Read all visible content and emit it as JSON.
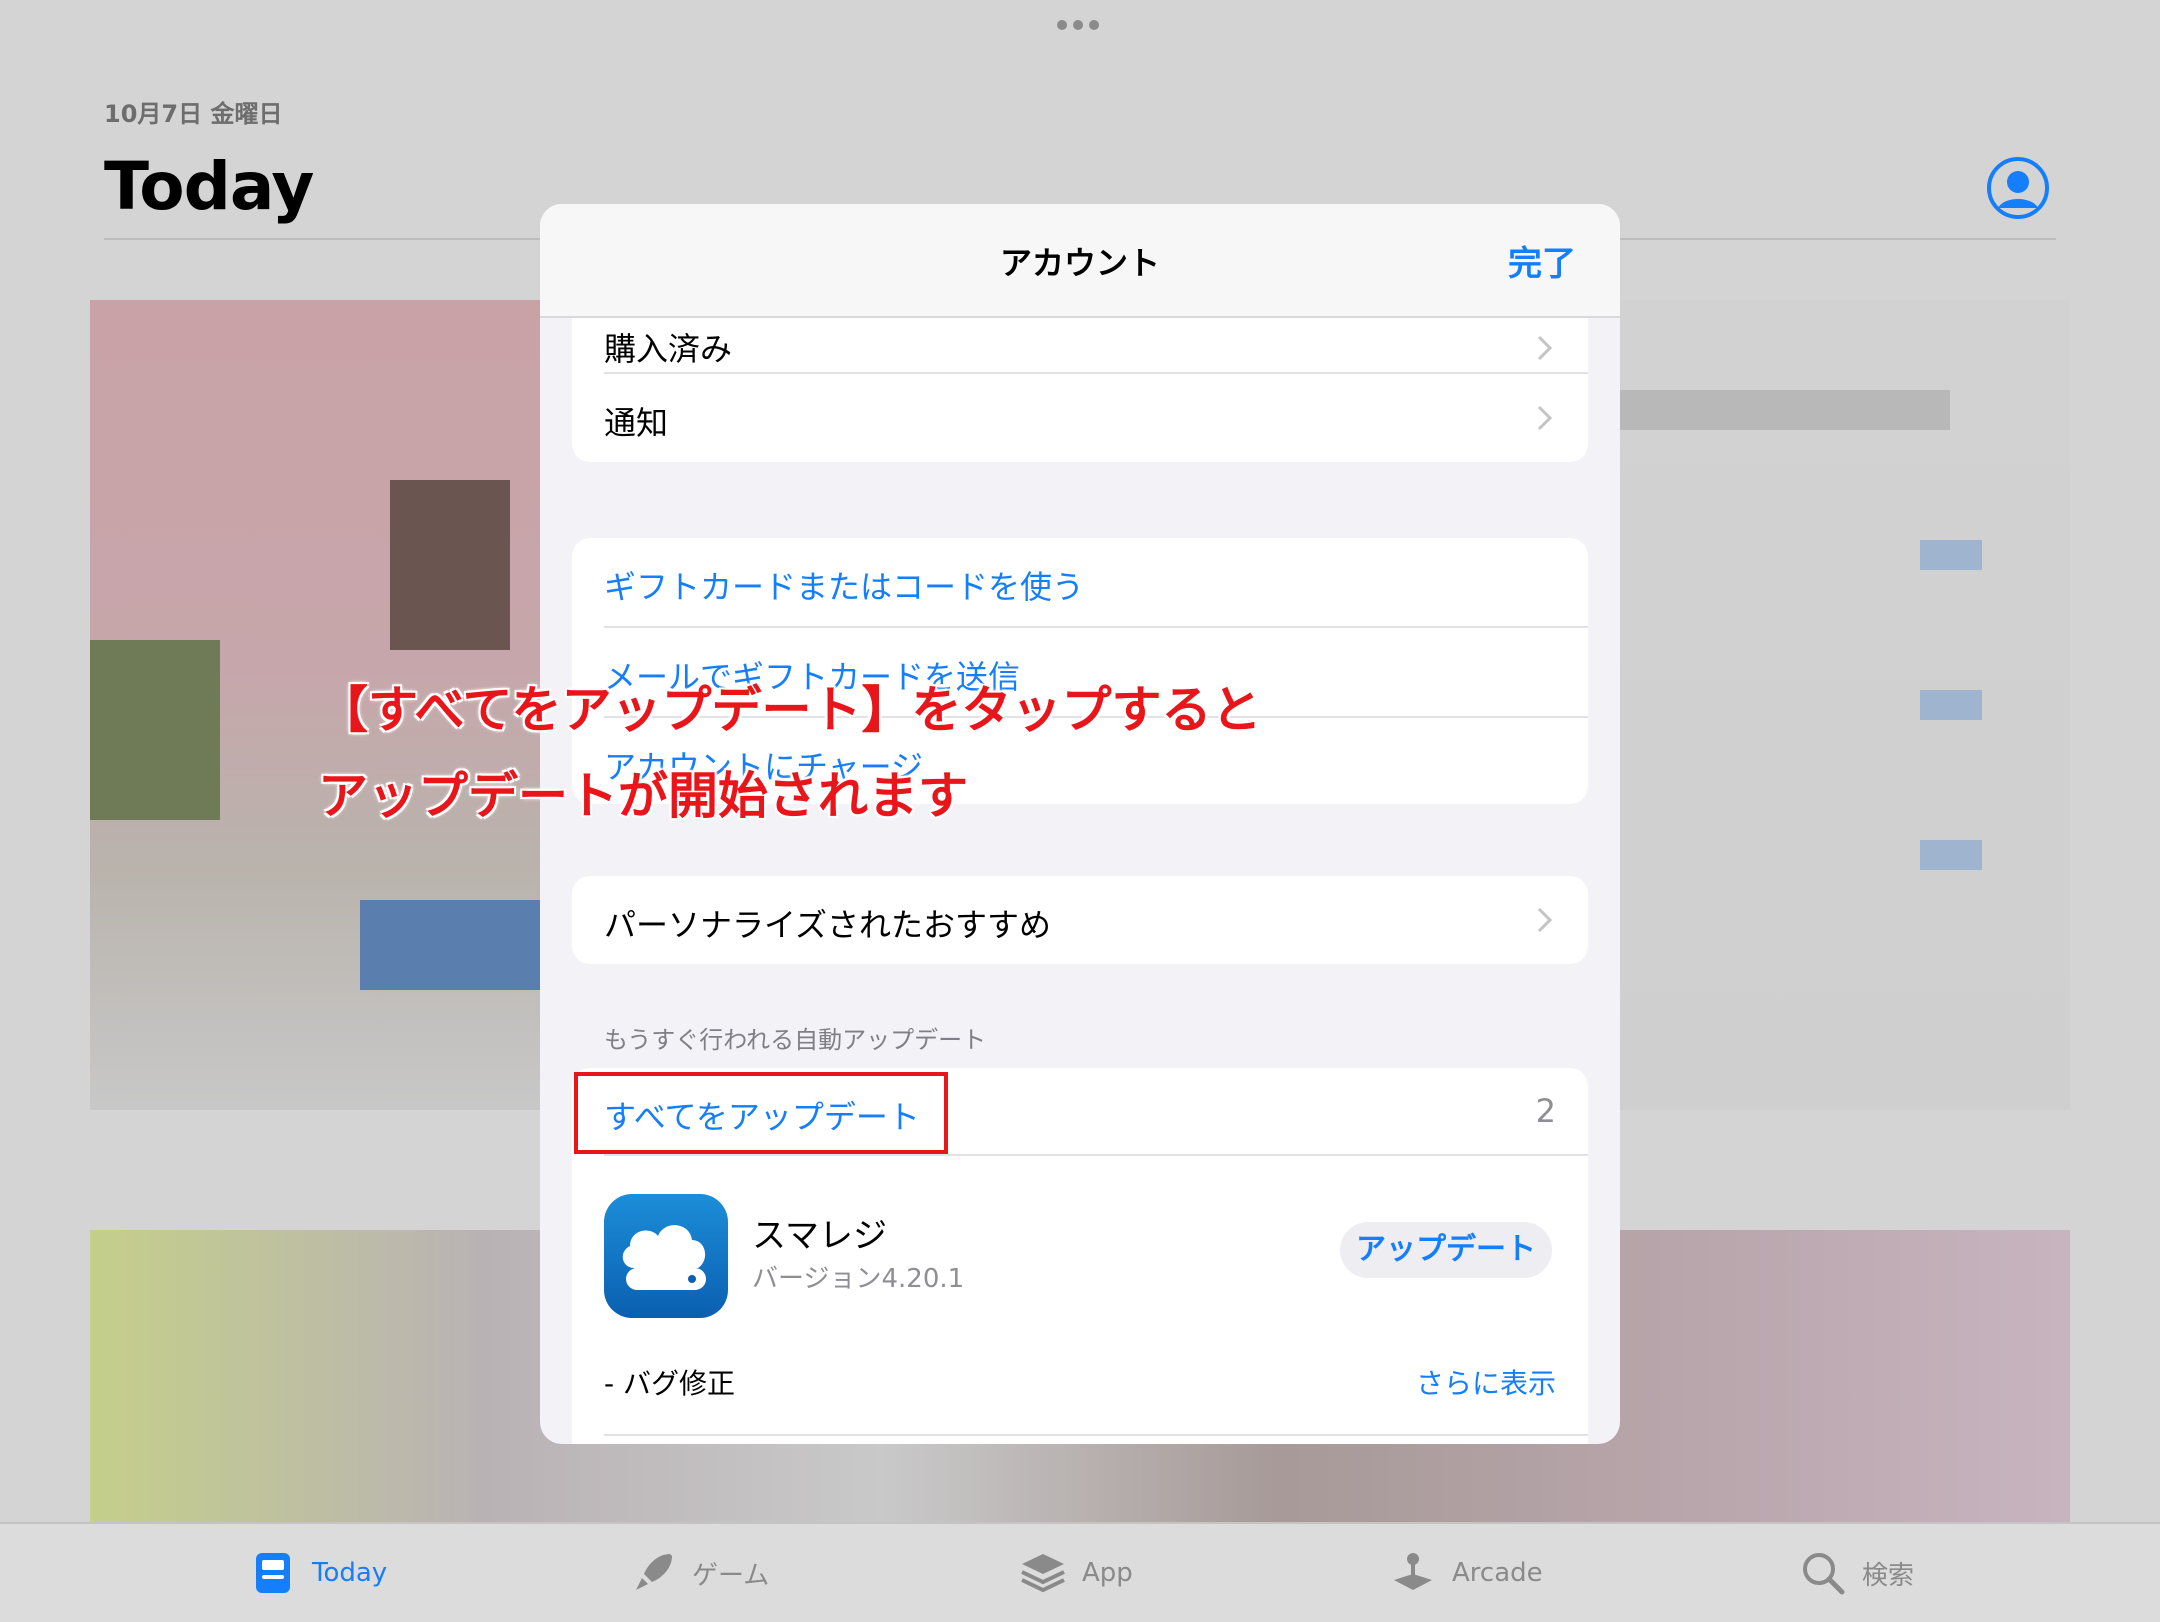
{
  "header": {
    "date": "10月7日 金曜日",
    "title": "Today"
  },
  "modal": {
    "title": "アカウント",
    "done_label": "完了",
    "group1": [
      "購入済み",
      "通知"
    ],
    "group2": [
      "ギフトカードまたはコードを使う",
      "メールでギフトカードを送信",
      "アカウントにチャージ"
    ],
    "group3": [
      "パーソナライズされたおすすめ"
    ],
    "updates_header": "もうすぐ行われる自動アップデート",
    "update_all_label": "すべてをアップデート",
    "update_count": "2",
    "app": {
      "name": "スマレジ",
      "version": "バージョン4.20.1",
      "button": "アップデート",
      "notes": "- バグ修正",
      "more": "さらに表示"
    }
  },
  "annotation": {
    "line1": "【すべてをアップデート】をタップすると",
    "line2": "アップデートが開始されます"
  },
  "tabbar": {
    "tabs": [
      {
        "label": "Today",
        "icon": "today-icon",
        "active": true
      },
      {
        "label": "ゲーム",
        "icon": "rocket-icon",
        "active": false
      },
      {
        "label": "App",
        "icon": "layers-icon",
        "active": false
      },
      {
        "label": "Arcade",
        "icon": "joystick-icon",
        "active": false
      },
      {
        "label": "検索",
        "icon": "search-icon",
        "active": false
      }
    ]
  },
  "colors": {
    "accent": "#157efb",
    "annotation_red": "#e8161b"
  }
}
